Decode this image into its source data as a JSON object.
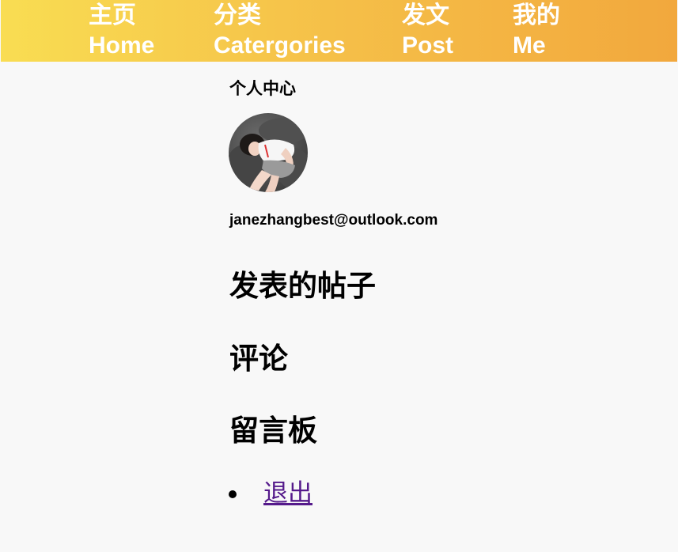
{
  "nav": {
    "home": {
      "zh": "主页",
      "en": "Home"
    },
    "categories": {
      "zh": "分类",
      "en": "Catergories"
    },
    "post": {
      "zh": "发文",
      "en": "Post"
    },
    "me": {
      "zh": "我的",
      "en": "Me"
    }
  },
  "profile": {
    "title": "个人中心",
    "email": "janezhangbest@outlook.com"
  },
  "sections": {
    "posts": "发表的帖子",
    "comments": "评论",
    "board": "留言板"
  },
  "menu": {
    "logout": "退出"
  },
  "colors": {
    "nav_gradient_start": "#f9dd52",
    "nav_gradient_end": "#f2a83d",
    "visited_link": "#551a8b"
  }
}
